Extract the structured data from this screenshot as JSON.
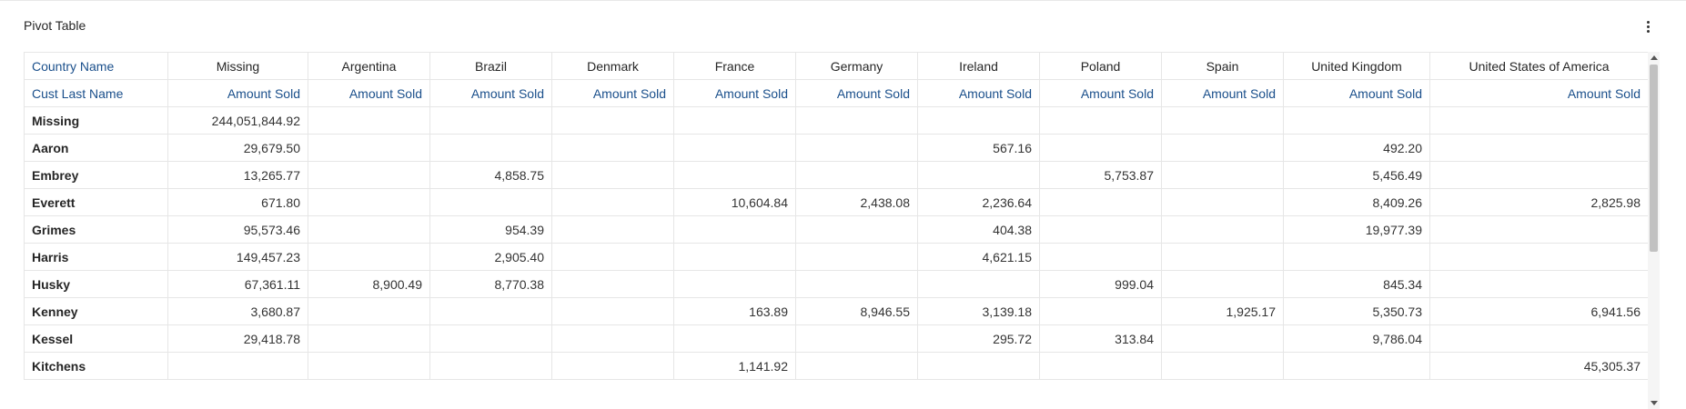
{
  "panel": {
    "title": "Pivot Table",
    "menu_icon": "kebab-menu-icon"
  },
  "table": {
    "column_axis_label": "Country Name",
    "row_axis_label": "Cust Last Name",
    "measure_label": "Amount Sold",
    "countries": [
      "Missing",
      "Argentina",
      "Brazil",
      "Denmark",
      "France",
      "Germany",
      "Ireland",
      "Poland",
      "Spain",
      "United Kingdom",
      "United States of America"
    ],
    "rows": [
      {
        "name": "Missing",
        "cells": [
          "244,051,844.92",
          "",
          "",
          "",
          "",
          "",
          "",
          "",
          "",
          "",
          ""
        ]
      },
      {
        "name": "Aaron",
        "cells": [
          "29,679.50",
          "",
          "",
          "",
          "",
          "",
          "567.16",
          "",
          "",
          "492.20",
          ""
        ]
      },
      {
        "name": "Embrey",
        "cells": [
          "13,265.77",
          "",
          "4,858.75",
          "",
          "",
          "",
          "",
          "5,753.87",
          "",
          "5,456.49",
          ""
        ]
      },
      {
        "name": "Everett",
        "cells": [
          "671.80",
          "",
          "",
          "",
          "10,604.84",
          "2,438.08",
          "2,236.64",
          "",
          "",
          "8,409.26",
          "2,825.98"
        ]
      },
      {
        "name": "Grimes",
        "cells": [
          "95,573.46",
          "",
          "954.39",
          "",
          "",
          "",
          "404.38",
          "",
          "",
          "19,977.39",
          ""
        ]
      },
      {
        "name": "Harris",
        "cells": [
          "149,457.23",
          "",
          "2,905.40",
          "",
          "",
          "",
          "4,621.15",
          "",
          "",
          "",
          ""
        ]
      },
      {
        "name": "Husky",
        "cells": [
          "67,361.11",
          "8,900.49",
          "8,770.38",
          "",
          "",
          "",
          "",
          "999.04",
          "",
          "845.34",
          ""
        ]
      },
      {
        "name": "Kenney",
        "cells": [
          "3,680.87",
          "",
          "",
          "",
          "163.89",
          "8,946.55",
          "3,139.18",
          "",
          "1,925.17",
          "5,350.73",
          "6,941.56"
        ]
      },
      {
        "name": "Kessel",
        "cells": [
          "29,418.78",
          "",
          "",
          "",
          "",
          "",
          "295.72",
          "313.84",
          "",
          "9,786.04",
          ""
        ]
      },
      {
        "name": "Kitchens",
        "cells": [
          "",
          "",
          "",
          "",
          "1,141.92",
          "",
          "",
          "",
          "",
          "",
          "45,305.37"
        ]
      }
    ]
  }
}
